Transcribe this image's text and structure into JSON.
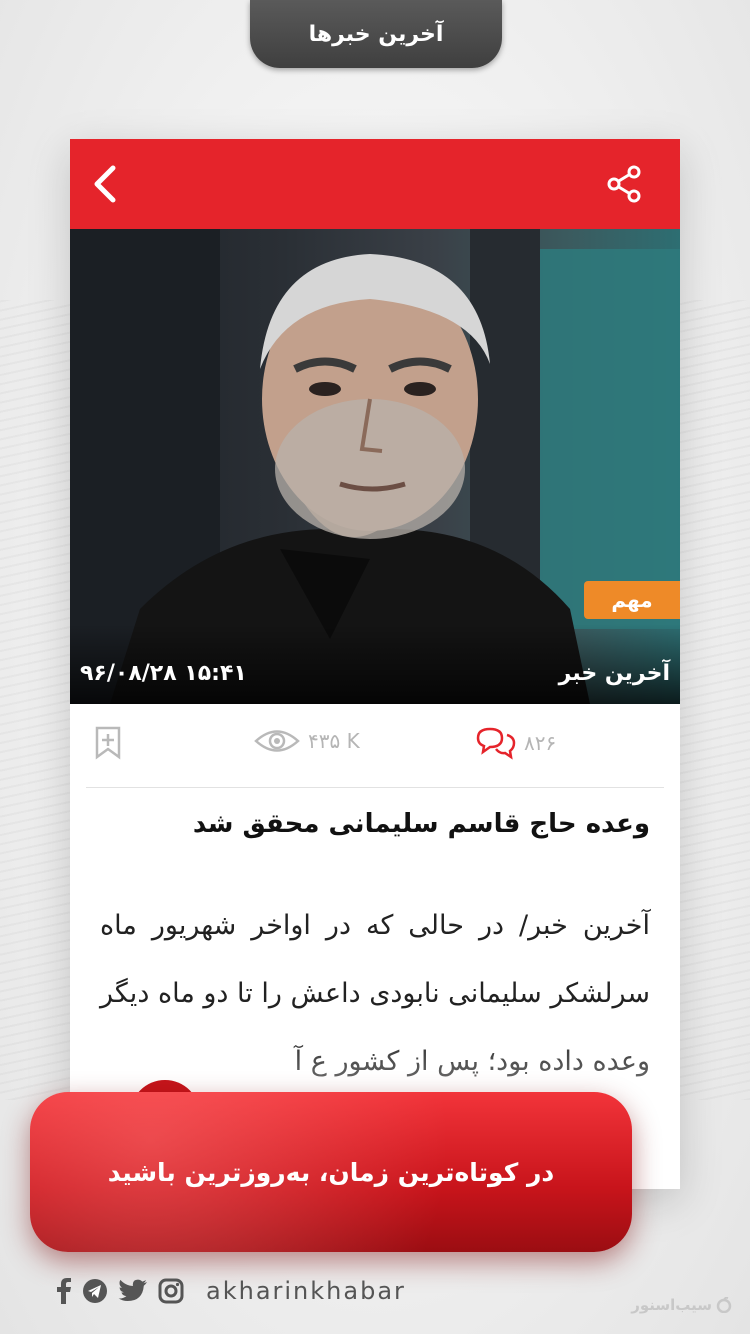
{
  "top_tab": {
    "title": "آخرین خبرها"
  },
  "article": {
    "badge": "مهم",
    "source": "آخرین خبر",
    "datetime": "۹۶/۰۸/۲۸  ۱۵:۴۱",
    "views": "۴۳۵ K",
    "comments": "۸۲۶",
    "headline": "وعده حاج قاسم سلیمانی محقق شد",
    "body": "آخرین خبر/ در حالی که در اواخر شهریور ماه سرلشکر سلیمانی نابودی داعش را تا دو ماه دیگر وعده داده بود؛ پس از کشور ع آ"
  },
  "banner": {
    "text": "در کوتاه‌ترین زمان، به‌روزترین باشید"
  },
  "footer": {
    "domain": "akharinkhabar",
    "social_icons": [
      "facebook-icon",
      "telegram-icon",
      "twitter-icon",
      "instagram-icon"
    ]
  },
  "watermark": {
    "text": "سیب‌اسنور"
  },
  "colors": {
    "header_red": "#e5242b",
    "badge_orange": "#ee8a28",
    "tab_dark": "#4a4a4a"
  }
}
